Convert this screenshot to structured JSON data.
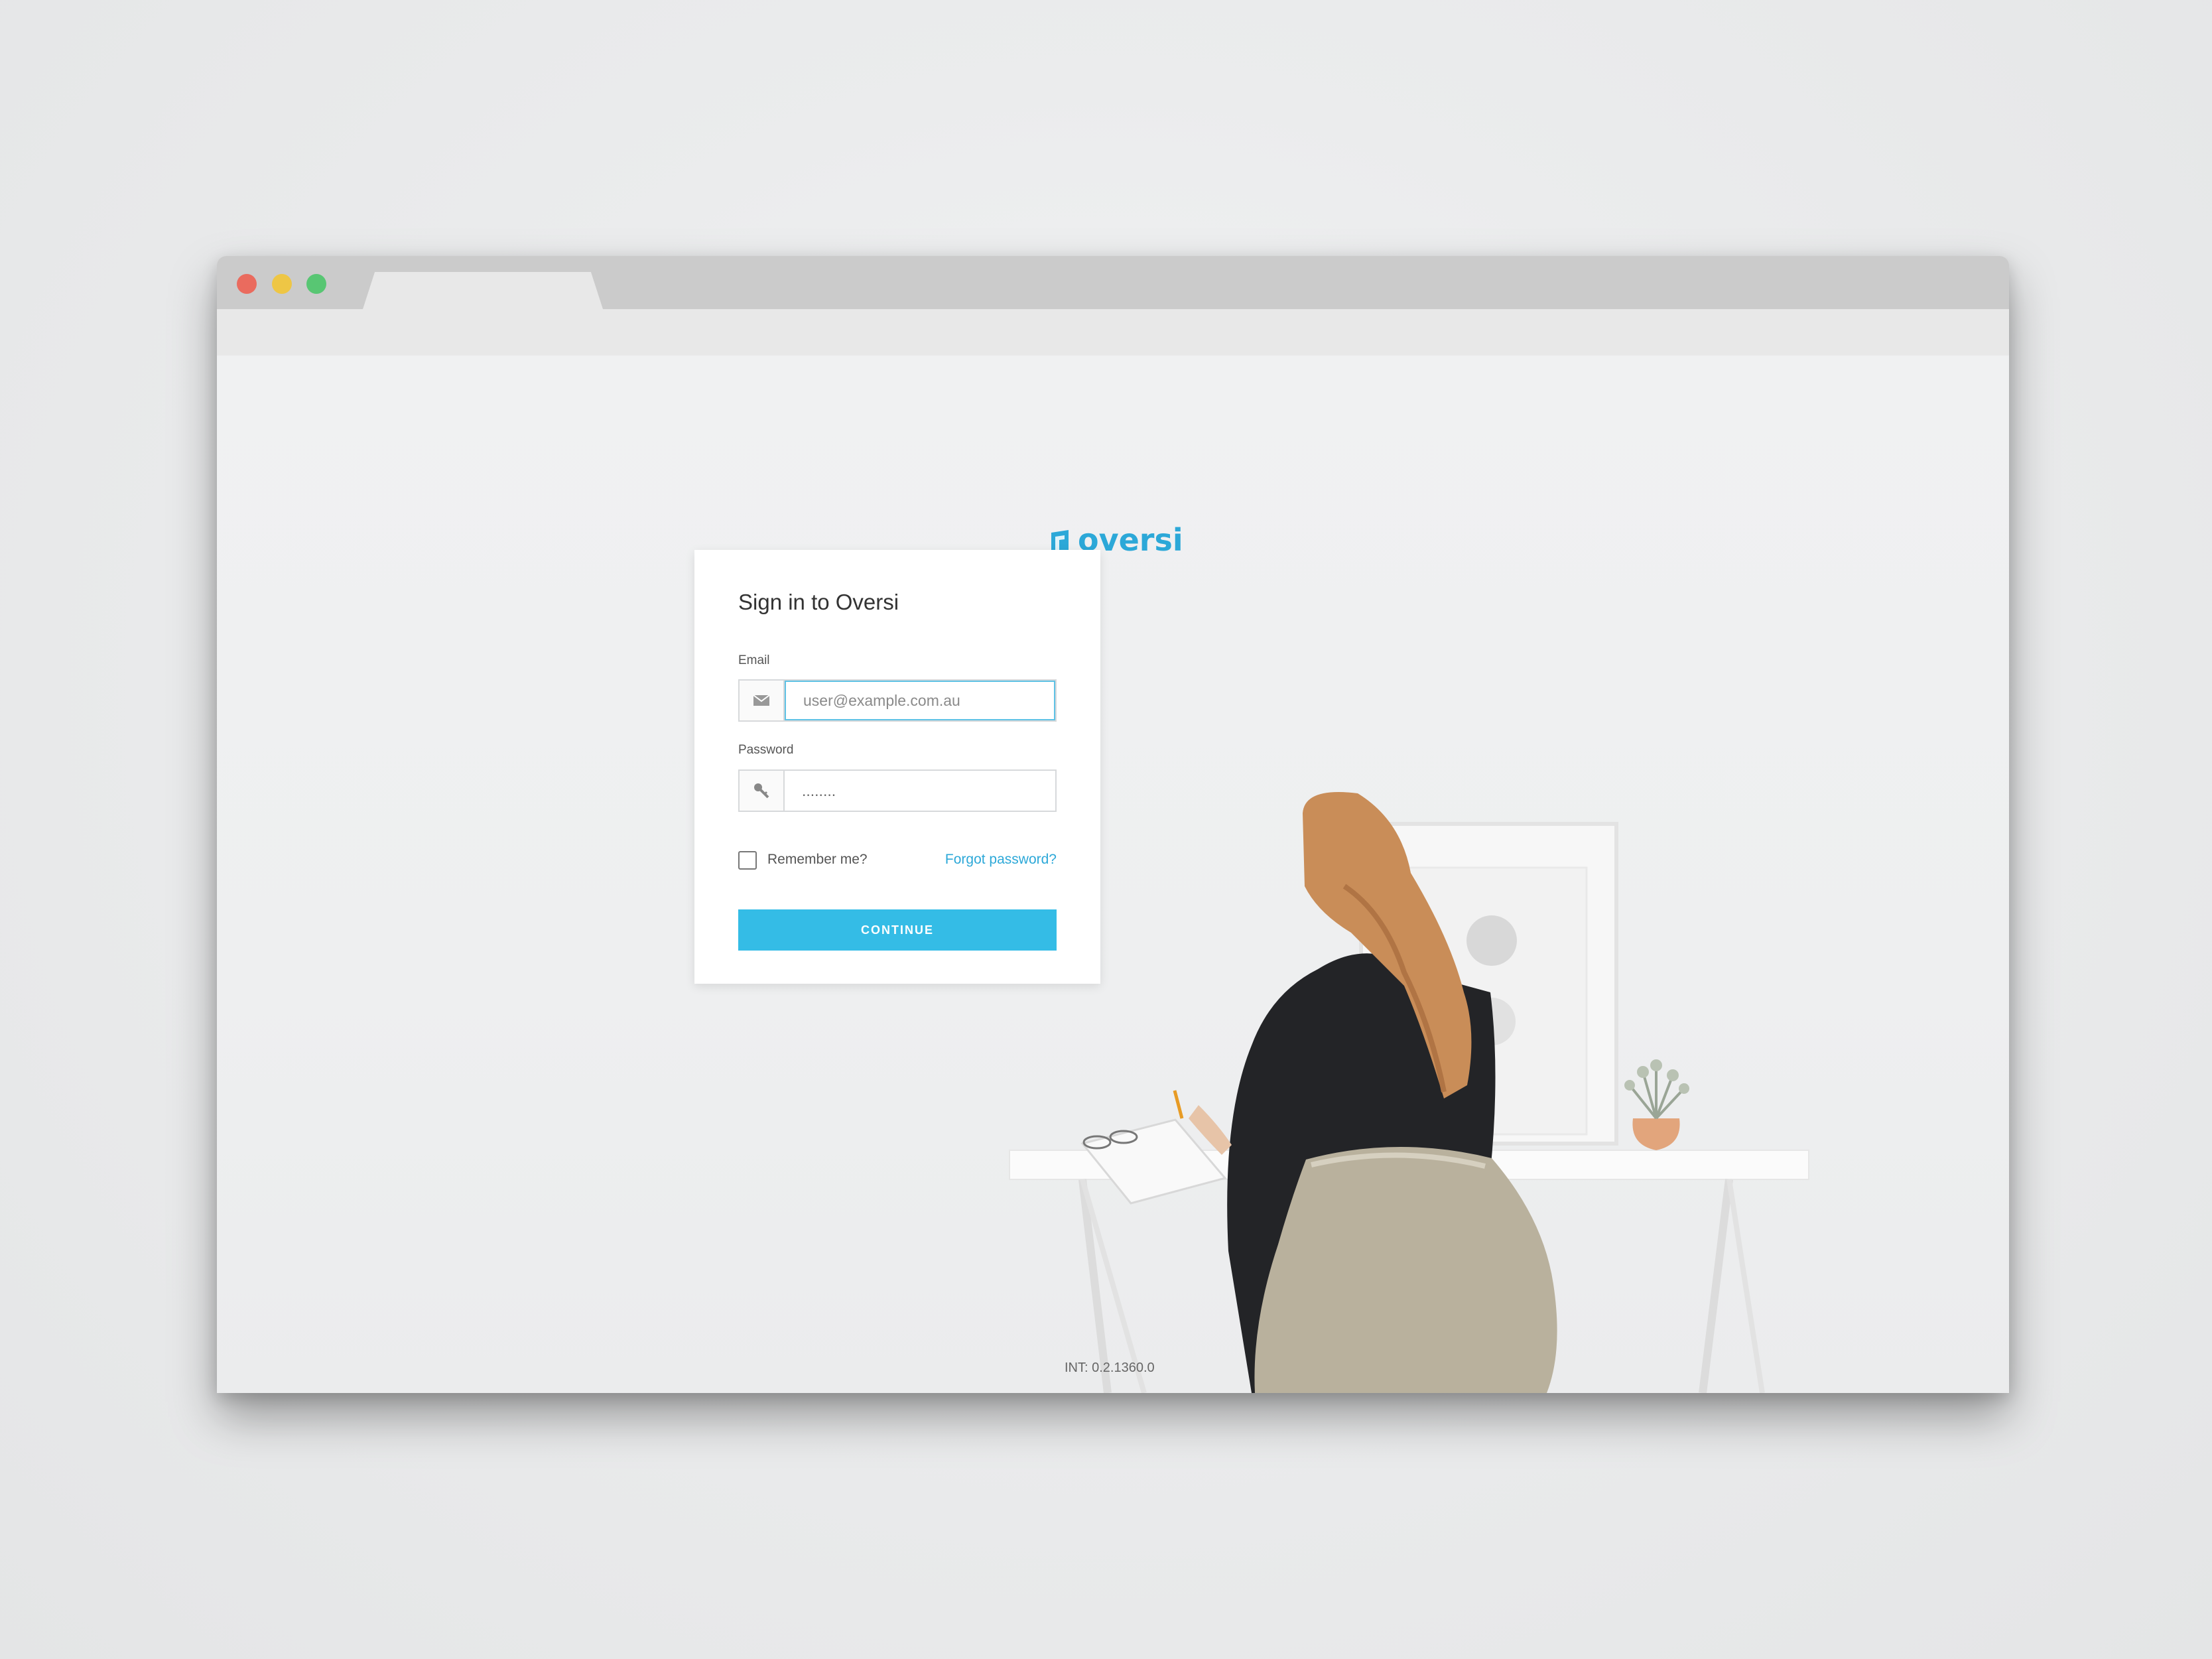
{
  "brand": {
    "name": "oversi",
    "accent_color": "#2ca8d8",
    "button_color": "#34bce6"
  },
  "window_controls": [
    "close",
    "minimize",
    "maximize"
  ],
  "login": {
    "title": "Sign in to Oversi",
    "email": {
      "label": "Email",
      "placeholder": "user@example.com.au",
      "icon": "envelope-icon"
    },
    "password": {
      "label": "Password",
      "value": "........",
      "icon": "key-icon"
    },
    "remember_label": "Remember me?",
    "forgot_label": "Forgot password?",
    "continue_label": "CONTINUE"
  },
  "footer": {
    "version": "INT: 0.2.1360.0"
  }
}
